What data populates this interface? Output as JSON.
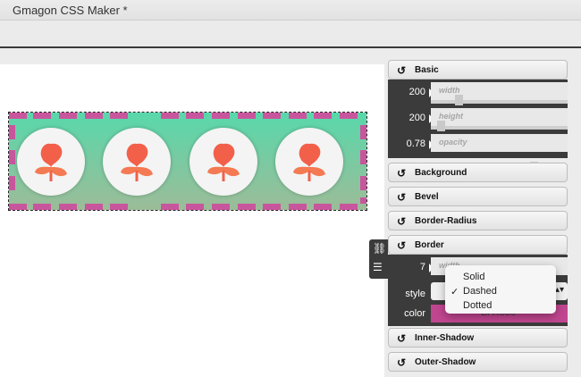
{
  "window": {
    "title": "Gmagon CSS Maker *"
  },
  "sections": {
    "basic": "Basic",
    "background": "Background",
    "bevel": "Bevel",
    "border_radius": "Border-Radius",
    "border": "Border",
    "inner_shadow": "Inner-Shadow",
    "outer_shadow": "Outer-Shadow"
  },
  "basic": {
    "width": {
      "label": "width",
      "value": "200"
    },
    "height": {
      "label": "height",
      "value": "200"
    },
    "opacity": {
      "label": "opacity",
      "value": "0.78"
    }
  },
  "border": {
    "width": {
      "label": "width",
      "value": "7"
    },
    "style_label": "style",
    "color_label": "color",
    "color_value": "BA4880",
    "style_options": [
      "Solid",
      "Dashed",
      "Dotted"
    ],
    "style_selected": "Dashed",
    "color_hex": "#c0468f"
  },
  "icons": {
    "section_toggle": "reset-arrow-icon",
    "side_tools": [
      "link-icon",
      "layers-icon"
    ]
  },
  "colors": {
    "gradient_top": "#58d8ab",
    "gradient_bottom": "#9cbc98",
    "dash": "#c8569d",
    "flower": "#f2604a"
  }
}
